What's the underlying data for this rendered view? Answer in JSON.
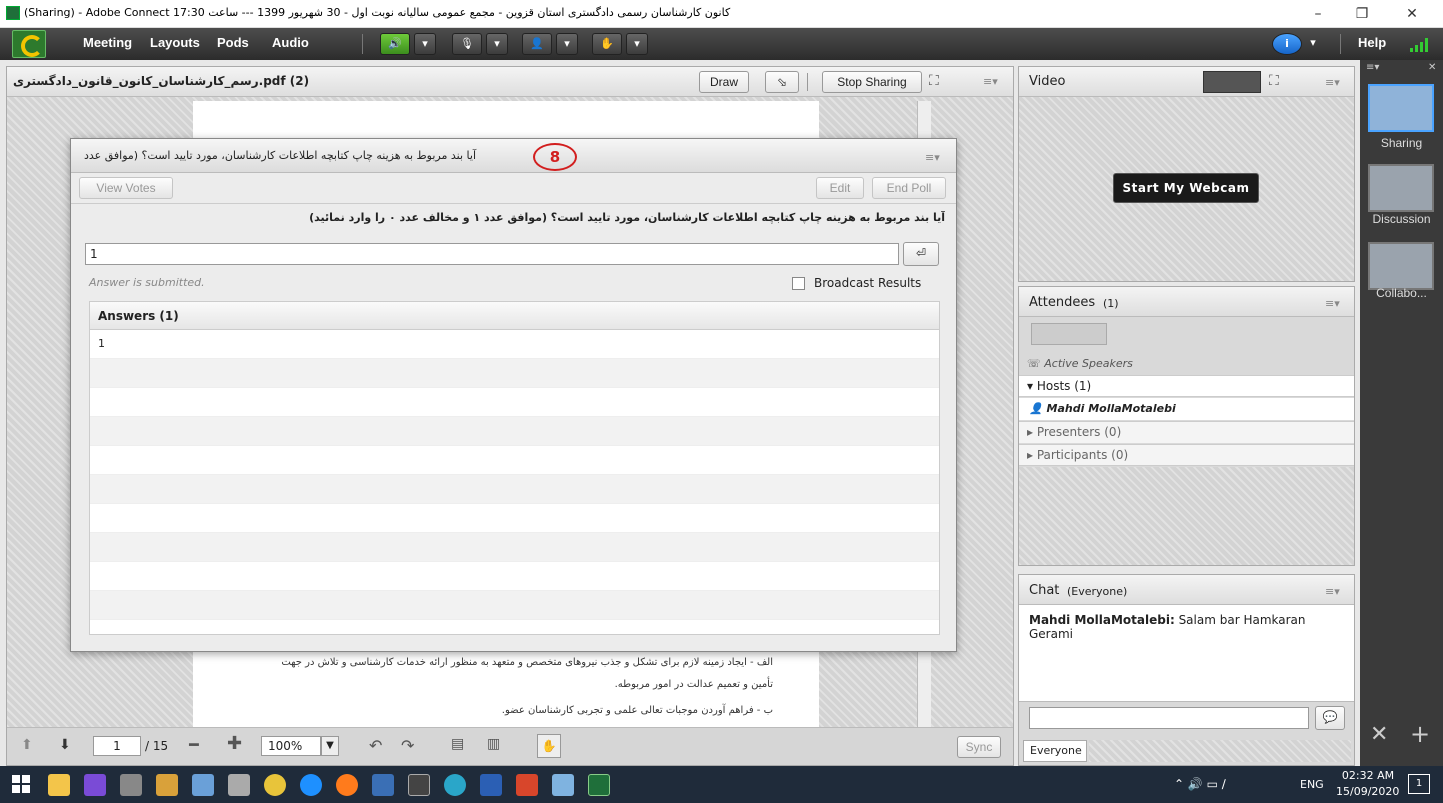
{
  "window": {
    "title": "(Sharing) - Adobe Connect  کانون کارشناسان رسمی دادگستری استان قزوین - مجمع عمومی سالیانه نوبت اول - 30 شهریور 1399  --- ساعت 17:30",
    "minimize": "–",
    "restore": "❐",
    "close": "✕"
  },
  "menubar": {
    "items": [
      "Meeting",
      "Layouts",
      "Pods",
      "Audio"
    ],
    "help": "Help",
    "info": "i"
  },
  "share_pod": {
    "title": "رسم_کارشناسان_کانون_قانون_دادگستری.pdf (2)",
    "draw": "Draw",
    "stop_sharing": "Stop Sharing",
    "page_current": "1",
    "page_total": "/ 15",
    "zoom": "100%",
    "sync": "Sync",
    "doc_lines": [
      "الف - ایجاد زمینه لازم برای تشکل و جذب نیروهای متخصص و متعهد به منظور ارائه خدمات کارشناسی و تلاش در جهت",
      "تأمین و تعمیم عدالت در امور مربوطه.",
      "ب - فراهم آوردن موجبات تعالی علمی و تجربی کارشناسان عضو."
    ]
  },
  "poll": {
    "title": "آیا بند مربوط به هزینه چاپ کتابچه اطلاعات کارشناسان، مورد تایید است؟ (موافق عدد",
    "annotation": "8",
    "view_votes": "View Votes",
    "edit": "Edit",
    "end_poll": "End Poll",
    "question": "آیا بند مربوط به هزینه چاپ کتابچه اطلاعات کارشناسان، مورد تایید است؟ (موافق عدد ۱  و مخالف عدد ۰  را وارد نمائید)",
    "answer_value": "1",
    "status": "Answer is submitted.",
    "broadcast": "Broadcast Results",
    "answers_header": "Answers (1)",
    "answers": [
      "1"
    ]
  },
  "video_pod": {
    "title": "Video",
    "start_webcam": "Start My Webcam"
  },
  "attendees_pod": {
    "title": "Attendees",
    "count": "(1)",
    "active_speakers": "Active Speakers",
    "hosts": "Hosts (1)",
    "host_name": "Mahdi MollaMotalebi",
    "presenters": "Presenters (0)",
    "participants": "Participants (0)"
  },
  "chat_pod": {
    "title": "Chat",
    "scope": "(Everyone)",
    "message_sender": "Mahdi MollaMotalebi:",
    "message_text": " Salam bar Hamkaran Gerami",
    "input_value": "",
    "tab": "Everyone"
  },
  "layouts": [
    "Sharing",
    "Discussion",
    "Collabo..."
  ],
  "taskbar": {
    "time": "02:32 AM",
    "date": "15/09/2020",
    "lang": "ENG",
    "notification_count": "1"
  }
}
